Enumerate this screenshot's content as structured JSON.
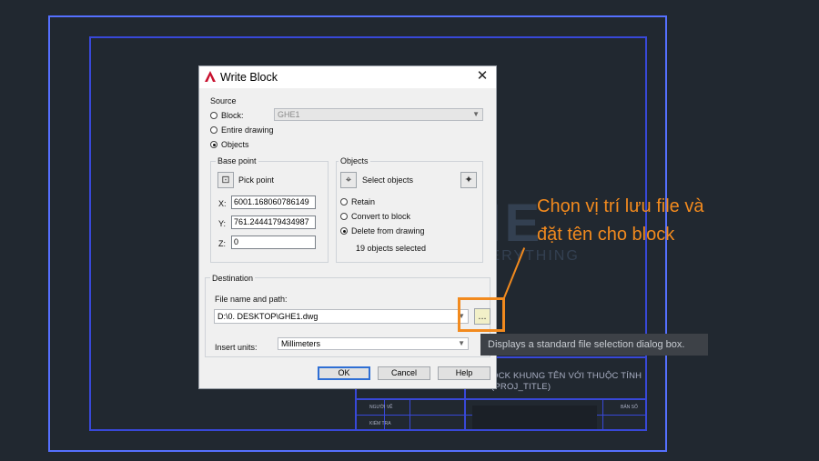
{
  "dialog": {
    "title": "Write Block",
    "close": "✕",
    "source": {
      "label": "Source",
      "block_label": "Block:",
      "block_value": "GHE1",
      "entire_drawing": "Entire drawing",
      "objects": "Objects"
    },
    "base_point": {
      "label": "Base point",
      "pick_point": "Pick point",
      "x_label": "X:",
      "x_value": "6001.168060786149",
      "y_label": "Y:",
      "y_value": "761.2444179434987",
      "z_label": "Z:",
      "z_value": "0"
    },
    "objects_group": {
      "label": "Objects",
      "select_objects": "Select objects",
      "retain": "Retain",
      "convert": "Convert to block",
      "delete": "Delete from drawing",
      "count": "19 objects selected"
    },
    "destination": {
      "label": "Destination",
      "file_label": "File name and path:",
      "file_value": "D:\\0. DESKTOP\\GHE1.dwg",
      "ellipsis": "...",
      "units_label": "Insert units:",
      "units_value": "Millimeters"
    },
    "buttons": {
      "ok": "OK",
      "cancel": "Cancel",
      "help": "Help"
    }
  },
  "annotation": {
    "line1": "Chọn vị trí lưu file và",
    "line2": "đặt tên cho block"
  },
  "tooltip": "Displays a standard file selection dialog box.",
  "watermark": {
    "main": "ECHE",
    "sub": "TRUST IS EVERYTHING"
  },
  "titleblock": {
    "title_line1": "OCK KHUNG TÊN VỚI THUỘC TÍNH",
    "title_line2": "(PROJ_TITLE)",
    "label_nguoi_ve": "NGƯỜI VẼ",
    "label_kiem_tra": "KIỂM TRA",
    "label_ban_so": "BẢN SỐ"
  },
  "colors": {
    "accent": "#f28a1e",
    "frame": "#5570ff",
    "background": "#212830"
  }
}
